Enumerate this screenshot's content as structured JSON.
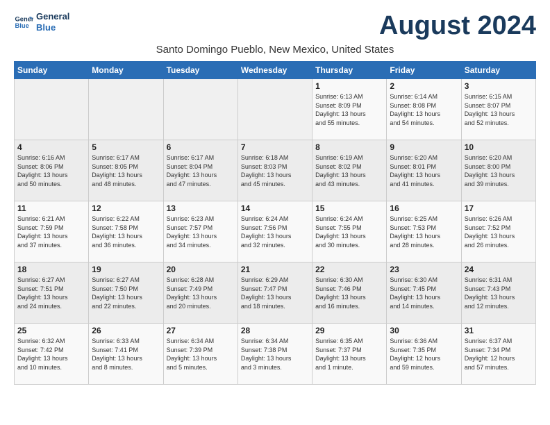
{
  "header": {
    "logo_line1": "General",
    "logo_line2": "Blue",
    "month_title": "August 2024",
    "location": "Santo Domingo Pueblo, New Mexico, United States"
  },
  "weekdays": [
    "Sunday",
    "Monday",
    "Tuesday",
    "Wednesday",
    "Thursday",
    "Friday",
    "Saturday"
  ],
  "weeks": [
    [
      {
        "day": "",
        "info": ""
      },
      {
        "day": "",
        "info": ""
      },
      {
        "day": "",
        "info": ""
      },
      {
        "day": "",
        "info": ""
      },
      {
        "day": "1",
        "info": "Sunrise: 6:13 AM\nSunset: 8:09 PM\nDaylight: 13 hours\nand 55 minutes."
      },
      {
        "day": "2",
        "info": "Sunrise: 6:14 AM\nSunset: 8:08 PM\nDaylight: 13 hours\nand 54 minutes."
      },
      {
        "day": "3",
        "info": "Sunrise: 6:15 AM\nSunset: 8:07 PM\nDaylight: 13 hours\nand 52 minutes."
      }
    ],
    [
      {
        "day": "4",
        "info": "Sunrise: 6:16 AM\nSunset: 8:06 PM\nDaylight: 13 hours\nand 50 minutes."
      },
      {
        "day": "5",
        "info": "Sunrise: 6:17 AM\nSunset: 8:05 PM\nDaylight: 13 hours\nand 48 minutes."
      },
      {
        "day": "6",
        "info": "Sunrise: 6:17 AM\nSunset: 8:04 PM\nDaylight: 13 hours\nand 47 minutes."
      },
      {
        "day": "7",
        "info": "Sunrise: 6:18 AM\nSunset: 8:03 PM\nDaylight: 13 hours\nand 45 minutes."
      },
      {
        "day": "8",
        "info": "Sunrise: 6:19 AM\nSunset: 8:02 PM\nDaylight: 13 hours\nand 43 minutes."
      },
      {
        "day": "9",
        "info": "Sunrise: 6:20 AM\nSunset: 8:01 PM\nDaylight: 13 hours\nand 41 minutes."
      },
      {
        "day": "10",
        "info": "Sunrise: 6:20 AM\nSunset: 8:00 PM\nDaylight: 13 hours\nand 39 minutes."
      }
    ],
    [
      {
        "day": "11",
        "info": "Sunrise: 6:21 AM\nSunset: 7:59 PM\nDaylight: 13 hours\nand 37 minutes."
      },
      {
        "day": "12",
        "info": "Sunrise: 6:22 AM\nSunset: 7:58 PM\nDaylight: 13 hours\nand 36 minutes."
      },
      {
        "day": "13",
        "info": "Sunrise: 6:23 AM\nSunset: 7:57 PM\nDaylight: 13 hours\nand 34 minutes."
      },
      {
        "day": "14",
        "info": "Sunrise: 6:24 AM\nSunset: 7:56 PM\nDaylight: 13 hours\nand 32 minutes."
      },
      {
        "day": "15",
        "info": "Sunrise: 6:24 AM\nSunset: 7:55 PM\nDaylight: 13 hours\nand 30 minutes."
      },
      {
        "day": "16",
        "info": "Sunrise: 6:25 AM\nSunset: 7:53 PM\nDaylight: 13 hours\nand 28 minutes."
      },
      {
        "day": "17",
        "info": "Sunrise: 6:26 AM\nSunset: 7:52 PM\nDaylight: 13 hours\nand 26 minutes."
      }
    ],
    [
      {
        "day": "18",
        "info": "Sunrise: 6:27 AM\nSunset: 7:51 PM\nDaylight: 13 hours\nand 24 minutes."
      },
      {
        "day": "19",
        "info": "Sunrise: 6:27 AM\nSunset: 7:50 PM\nDaylight: 13 hours\nand 22 minutes."
      },
      {
        "day": "20",
        "info": "Sunrise: 6:28 AM\nSunset: 7:49 PM\nDaylight: 13 hours\nand 20 minutes."
      },
      {
        "day": "21",
        "info": "Sunrise: 6:29 AM\nSunset: 7:47 PM\nDaylight: 13 hours\nand 18 minutes."
      },
      {
        "day": "22",
        "info": "Sunrise: 6:30 AM\nSunset: 7:46 PM\nDaylight: 13 hours\nand 16 minutes."
      },
      {
        "day": "23",
        "info": "Sunrise: 6:30 AM\nSunset: 7:45 PM\nDaylight: 13 hours\nand 14 minutes."
      },
      {
        "day": "24",
        "info": "Sunrise: 6:31 AM\nSunset: 7:43 PM\nDaylight: 13 hours\nand 12 minutes."
      }
    ],
    [
      {
        "day": "25",
        "info": "Sunrise: 6:32 AM\nSunset: 7:42 PM\nDaylight: 13 hours\nand 10 minutes."
      },
      {
        "day": "26",
        "info": "Sunrise: 6:33 AM\nSunset: 7:41 PM\nDaylight: 13 hours\nand 8 minutes."
      },
      {
        "day": "27",
        "info": "Sunrise: 6:34 AM\nSunset: 7:39 PM\nDaylight: 13 hours\nand 5 minutes."
      },
      {
        "day": "28",
        "info": "Sunrise: 6:34 AM\nSunset: 7:38 PM\nDaylight: 13 hours\nand 3 minutes."
      },
      {
        "day": "29",
        "info": "Sunrise: 6:35 AM\nSunset: 7:37 PM\nDaylight: 13 hours\nand 1 minute."
      },
      {
        "day": "30",
        "info": "Sunrise: 6:36 AM\nSunset: 7:35 PM\nDaylight: 12 hours\nand 59 minutes."
      },
      {
        "day": "31",
        "info": "Sunrise: 6:37 AM\nSunset: 7:34 PM\nDaylight: 12 hours\nand 57 minutes."
      }
    ]
  ]
}
